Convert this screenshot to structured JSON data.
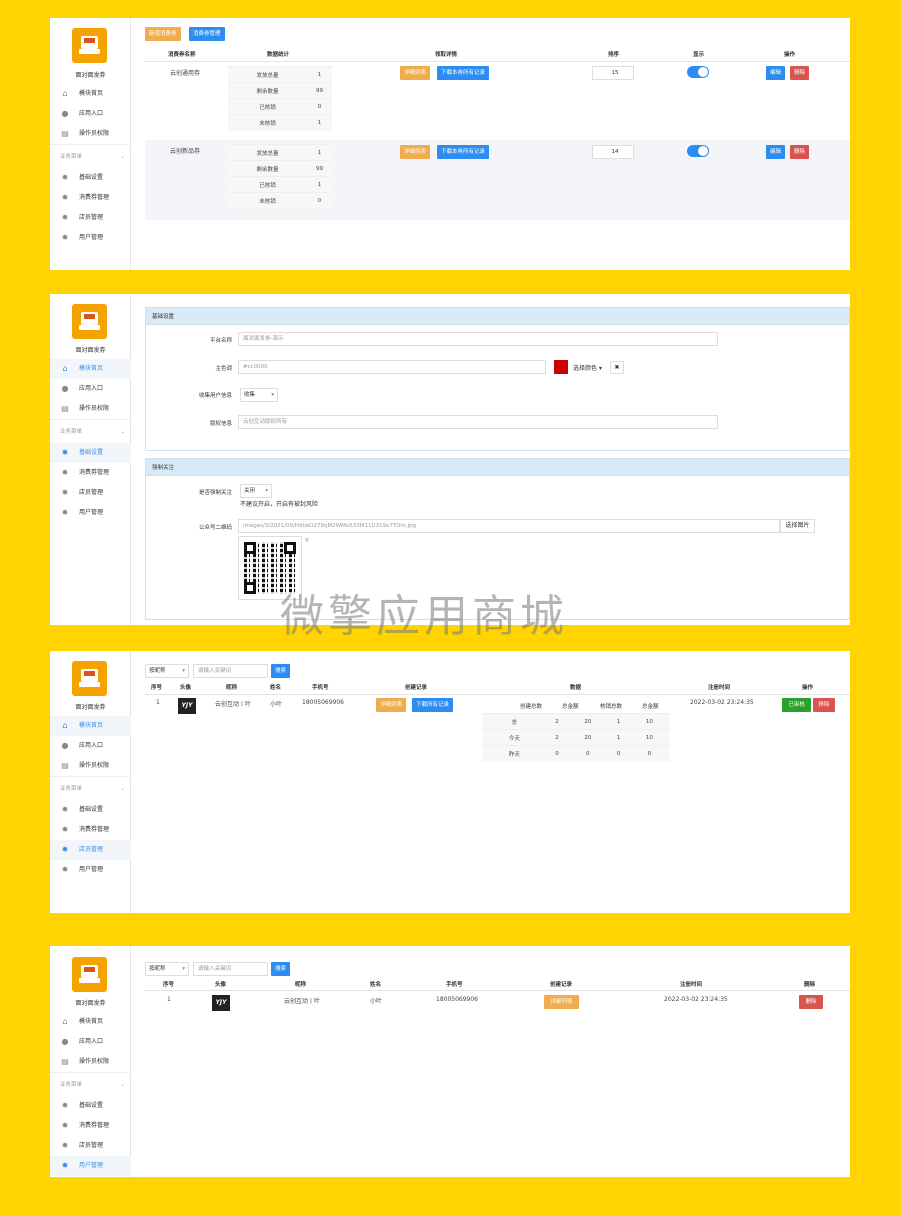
{
  "brand": "面对面发券",
  "nav": {
    "home": "模块首页",
    "app": "应用入口",
    "perm": "操作员权限",
    "group": "业务菜单",
    "basic": "基础设置",
    "coupon": "消费券管理",
    "store": "店员管理",
    "user": "用户管理"
  },
  "icons": {
    "home": "home-icon",
    "chat": "chat-icon",
    "doc": "document-icon",
    "gear": "gear-icon",
    "chevron": "chevron-down-icon"
  },
  "p1": {
    "btn_add": "新增消费券",
    "btn_manage": "消费券管理",
    "headers": [
      "消费券名称",
      "数据统计",
      "领取详情",
      "排序",
      "显示",
      "操作"
    ],
    "rows": [
      {
        "name": "云创通用券",
        "stats": [
          [
            "发放总量",
            "1"
          ],
          [
            "剩余数量",
            "99"
          ],
          [
            "已核销",
            "0"
          ],
          [
            "未核销",
            "1"
          ]
        ],
        "detail": "详细列表",
        "download": "下载本券所有记录",
        "sort": "15",
        "edit": "编辑",
        "del": "删除"
      },
      {
        "name": "云创新品券",
        "stats": [
          [
            "发放总量",
            "1"
          ],
          [
            "剩余数量",
            "99"
          ],
          [
            "已核销",
            "1"
          ],
          [
            "未核销",
            "0"
          ]
        ],
        "detail": "详细列表",
        "download": "下载本券所有记录",
        "sort": "14",
        "edit": "编辑",
        "del": "删除"
      }
    ]
  },
  "p2": {
    "sec1": "基础设置",
    "platform_label": "平台名称",
    "platform_ph": "面对面发券-演示",
    "color_label": "主色调",
    "color_ph": "#cc0000",
    "color_value": "#cc0000",
    "color_btn": "选择颜色 ▾",
    "color_clear": "✖",
    "collect_label": "收集用户信息",
    "collect_value": "收集",
    "copyright_label": "版权信息",
    "copyright_ph": "云创互动版权所有",
    "sec2": "强制关注",
    "force_label": "是否强制关注",
    "force_value": "关闭",
    "force_note": "不建议开启，开启有被封风险",
    "qr_label": "公众号二维码",
    "qr_path": "images/3/2021/09/HdtwO279qM2WMo533M11U319x7TDm.jpg",
    "qr_btn": "选择图片",
    "qr_close": "×"
  },
  "watermark": "微擎应用商城",
  "p3": {
    "filter": "按昵称",
    "search_ph": "请输入关键词",
    "search_btn": "搜索",
    "headers": [
      "序号",
      "头像",
      "昵称",
      "姓名",
      "手机号",
      "创建记录",
      "数据",
      "注册时间",
      "操作"
    ],
    "row": {
      "no": "1",
      "avatar": "YJY",
      "nick": "云创互动丨叶",
      "name": "小叶",
      "phone": "18005069906",
      "detail": "详细列表",
      "download": "下载所有记录",
      "time": "2022-03-02 23:24:35",
      "audit": "已审核",
      "del": "移除"
    },
    "stat_headers": [
      "创建总数",
      "总金额",
      "核销总数",
      "总金额"
    ],
    "stat_rows": [
      [
        "总",
        "2",
        "20",
        "1",
        "10"
      ],
      [
        "今天",
        "2",
        "20",
        "1",
        "10"
      ],
      [
        "昨天",
        "0",
        "0",
        "0",
        "0"
      ]
    ]
  },
  "p4": {
    "filter": "按昵称",
    "search_ph": "请输入关键词",
    "search_btn": "搜索",
    "headers": [
      "序号",
      "头像",
      "昵称",
      "姓名",
      "手机号",
      "创建记录",
      "注册时间",
      "删除"
    ],
    "row": {
      "no": "1",
      "avatar": "YJY",
      "nick": "云创互动丨叶",
      "name": "小叶",
      "phone": "18005069906",
      "detail": "详细列表",
      "time": "2022-03-02 23:24:35",
      "del": "删除"
    }
  }
}
